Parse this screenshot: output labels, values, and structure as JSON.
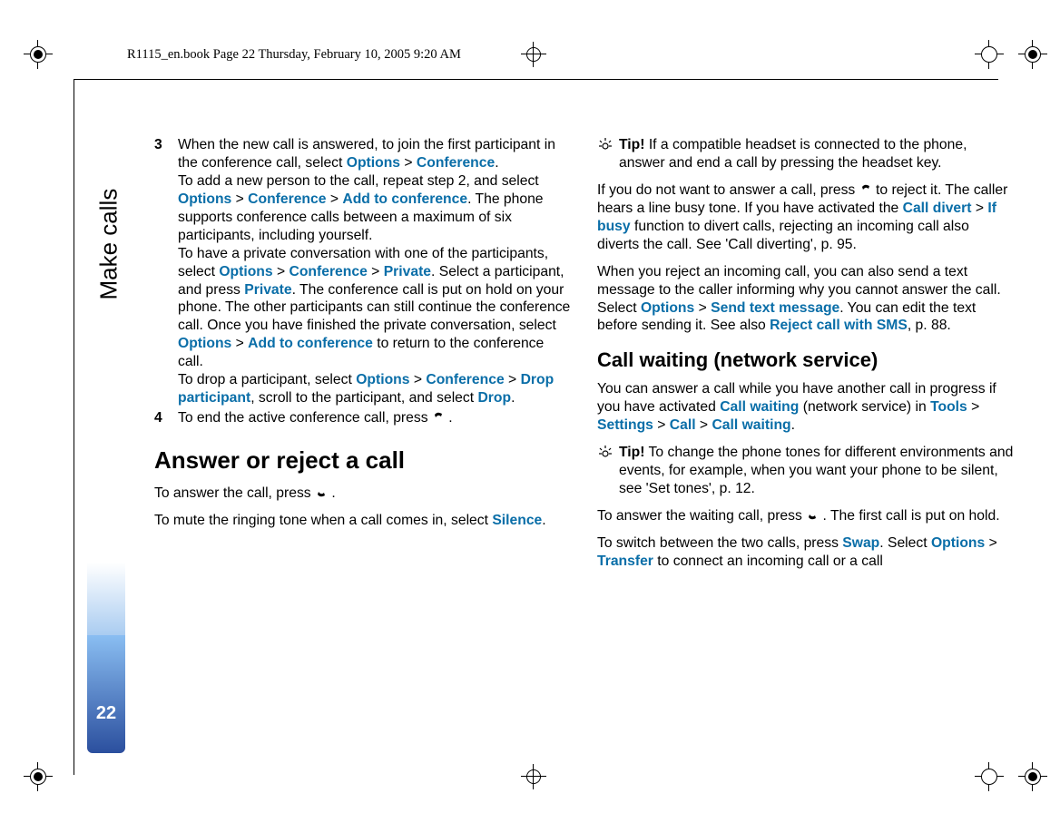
{
  "header": {
    "crop_text": "R1115_en.book  Page 22  Thursday, February 10, 2005  9:20 AM"
  },
  "side": {
    "section": "Make calls",
    "page": "22"
  },
  "ui": {
    "options": "Options",
    "conference": "Conference",
    "add_to_conference": "Add to conference",
    "private": "Private",
    "drop_participant": "Drop participant",
    "drop": "Drop",
    "silence": "Silence",
    "call_divert": "Call divert",
    "if_busy": "If busy",
    "send_text_message": "Send text message",
    "reject_call_with_sms": "Reject call with SMS",
    "call_waiting": "Call waiting",
    "tools": "Tools",
    "settings": "Settings",
    "call": "Call",
    "swap": "Swap",
    "transfer": "Transfer"
  },
  "left": {
    "step3_a1": "When the new call is answered, to join the first participant in the conference call, select ",
    "step3_a2": " > ",
    "step3_a3": ".",
    "step3_b1": "To add a new person to the call, repeat step 2, and select ",
    "step3_b2": " > ",
    "step3_b3": " > ",
    "step3_b4": ". The phone supports conference calls between a maximum of six participants, including yourself.",
    "step3_c1": "To have a private conversation with one of the participants, select ",
    "step3_c2": " > ",
    "step3_c3": " > ",
    "step3_c4": ". Select a participant, and press ",
    "step3_c5": ". The conference call is put on hold on your phone. The other participants can still continue the conference call. Once you have finished the private conversation, select ",
    "step3_c6": " > ",
    "step3_c7": " to return to the conference call.",
    "step3_d1": "To drop a participant, select ",
    "step3_d2": " > ",
    "step3_d3": " > ",
    "step3_d4": ", scroll to the participant, and select ",
    "step3_d5": ".",
    "step4": "To end the active conference call, press ",
    "step4_end": " .",
    "h2": "Answer or reject a call",
    "answer": "To answer the call, press ",
    "answer_end": " .",
    "mute1": "To mute the ringing tone when a call comes in, select ",
    "mute2": "."
  },
  "right": {
    "tip1_label": "Tip!",
    "tip1": " If a compatible headset is connected to the phone, answer and end a call by pressing the headset key.",
    "reject1": "If you do not want to answer a call, press ",
    "reject2": "  to reject it. The caller hears a line busy tone. If you have activated the ",
    "reject3": " > ",
    "reject4": " function to divert calls, rejecting an incoming call also diverts the call. See 'Call diverting', p. 95.",
    "sms1": "When you reject an incoming call, you can also send a text message to the caller informing why you cannot answer the call. Select ",
    "sms2": " > ",
    "sms3": ". You can edit the text before sending it. See also ",
    "sms4": ", p. 88.",
    "h3": "Call waiting (network service)",
    "cw1": "You can answer a call while you have another call in progress if you have activated ",
    "cw2": " (network service) in ",
    "cw3": " > ",
    "cw4": " > ",
    "cw5": " > ",
    "cw6": ".",
    "tip2_label": "Tip!",
    "tip2": " To change the phone tones for different environments and events, for example, when you want your phone to be silent, see 'Set tones', p. 12.",
    "wait1": "To answer the waiting call, press ",
    "wait2": " . The first call is put on hold.",
    "switch1": "To switch between the two calls, press ",
    "switch2": ". Select ",
    "switch3": " > ",
    "switch4": " to connect an incoming call or a call"
  }
}
